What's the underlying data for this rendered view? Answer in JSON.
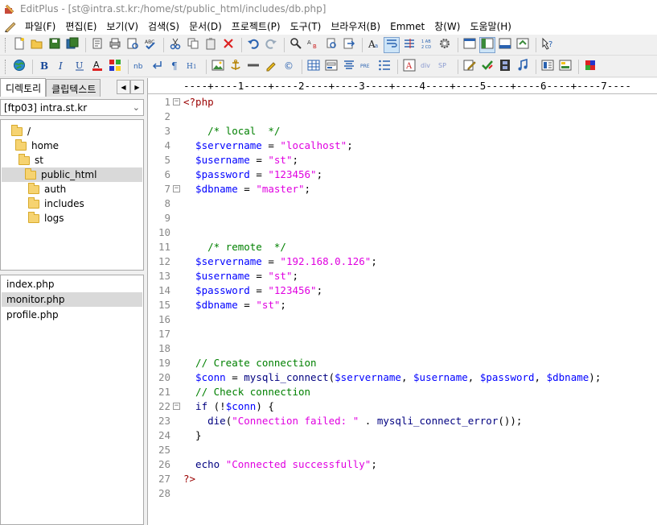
{
  "window": {
    "title": "EditPlus - [st@intra.st.kr:/home/st/public_html/includes/db.php]"
  },
  "menu": [
    {
      "label": "파일(F)"
    },
    {
      "label": "편집(E)"
    },
    {
      "label": "보기(V)"
    },
    {
      "label": "검색(S)"
    },
    {
      "label": "문서(D)"
    },
    {
      "label": "프로젝트(P)"
    },
    {
      "label": "도구(T)"
    },
    {
      "label": "브라우저(B)"
    },
    {
      "label": "Emmet"
    },
    {
      "label": "창(W)"
    },
    {
      "label": "도움말(H)"
    }
  ],
  "toolbar1": [
    "new-file-icon",
    "open-folder-icon",
    "save-icon",
    "save-all-icon",
    "sep",
    "cut-icon",
    "print-icon",
    "preview-icon",
    "spellcheck-icon",
    "sep",
    "scissors-icon",
    "copy-icon",
    "paste-icon",
    "delete-icon",
    "sep",
    "undo-icon",
    "redo-icon",
    "sep",
    "find-icon",
    "replace-icon",
    "find-in-files-icon",
    "goto-line-icon",
    "sep",
    "font-icon",
    "word-wrap-icon",
    "column-icon",
    "ruler-icon",
    "settings-icon",
    "sep",
    "window-icon",
    "sidebar-icon",
    "output-icon",
    "cliptext-icon",
    "sep",
    "help-icon"
  ],
  "toolbar2": [
    "browser-icon",
    "sep",
    "bold-icon",
    "italic-icon",
    "underline-icon",
    "font-color-icon",
    "color-palette-icon",
    "sep",
    "nbsp-icon",
    "break-icon",
    "paragraph-icon",
    "heading-icon",
    "sep",
    "image-icon",
    "anchor-icon",
    "hr-icon",
    "marker-icon",
    "copyright-icon",
    "sep",
    "table-icon",
    "form-icon",
    "center-icon",
    "pre-icon",
    "list-icon",
    "sep",
    "text-icon",
    "div-icon",
    "span-icon",
    "sep",
    "edit-icon",
    "check-icon",
    "film-icon",
    "music-icon",
    "sep",
    "layout-icon",
    "panel-icon",
    "sep",
    "palette-icon"
  ],
  "sidebar": {
    "tabs": [
      {
        "label": "디렉토리"
      },
      {
        "label": "클립텍스트"
      }
    ],
    "ftp_account": "[ftp03] intra.st.kr",
    "tree": [
      {
        "label": "/",
        "depth": 0
      },
      {
        "label": "home",
        "depth": 1
      },
      {
        "label": "st",
        "depth": 2
      },
      {
        "label": "public_html",
        "depth": 3
      },
      {
        "label": "auth",
        "depth": 4
      },
      {
        "label": "includes",
        "depth": 4
      },
      {
        "label": "logs",
        "depth": 4
      }
    ],
    "files": [
      {
        "label": "index.php"
      },
      {
        "label": "monitor.php"
      },
      {
        "label": "profile.php"
      }
    ]
  },
  "editor": {
    "ruler": "----+----1----+----2----+----3----+----4----+----5----+----6----+----7----",
    "lines": [
      {
        "n": "1",
        "fold": true,
        "tokens": [
          {
            "t": "<?php",
            "c": "tag"
          }
        ]
      },
      {
        "n": "2",
        "tokens": []
      },
      {
        "n": "3",
        "tokens": [
          {
            "t": "    /* local  */",
            "c": "com"
          }
        ]
      },
      {
        "n": "4",
        "tokens": [
          {
            "t": "  $servername",
            "c": "var"
          },
          {
            "t": " = ",
            "c": "op"
          },
          {
            "t": "\"localhost\"",
            "c": "str"
          },
          {
            "t": ";",
            "c": "op"
          }
        ]
      },
      {
        "n": "5",
        "tokens": [
          {
            "t": "  $username",
            "c": "var"
          },
          {
            "t": " = ",
            "c": "op"
          },
          {
            "t": "\"st\"",
            "c": "str"
          },
          {
            "t": ";",
            "c": "op"
          }
        ]
      },
      {
        "n": "6",
        "tokens": [
          {
            "t": "  $password",
            "c": "var"
          },
          {
            "t": " = ",
            "c": "op"
          },
          {
            "t": "\"123456\"",
            "c": "str"
          },
          {
            "t": ";",
            "c": "op"
          }
        ]
      },
      {
        "n": "7",
        "fold": true,
        "tokens": [
          {
            "t": "  $dbname",
            "c": "var"
          },
          {
            "t": " = ",
            "c": "op"
          },
          {
            "t": "\"master\"",
            "c": "str"
          },
          {
            "t": ";",
            "c": "op"
          }
        ]
      },
      {
        "n": "8",
        "tokens": []
      },
      {
        "n": "9",
        "tokens": []
      },
      {
        "n": "10",
        "tokens": []
      },
      {
        "n": "11",
        "tokens": [
          {
            "t": "    /* remote  */",
            "c": "com"
          }
        ]
      },
      {
        "n": "12",
        "tokens": [
          {
            "t": "  $servername",
            "c": "var"
          },
          {
            "t": " = ",
            "c": "op"
          },
          {
            "t": "\"192.168.0.126\"",
            "c": "str"
          },
          {
            "t": ";",
            "c": "op"
          }
        ]
      },
      {
        "n": "13",
        "tokens": [
          {
            "t": "  $username",
            "c": "var"
          },
          {
            "t": " = ",
            "c": "op"
          },
          {
            "t": "\"st\"",
            "c": "str"
          },
          {
            "t": ";",
            "c": "op"
          }
        ]
      },
      {
        "n": "14",
        "tokens": [
          {
            "t": "  $password",
            "c": "var"
          },
          {
            "t": " = ",
            "c": "op"
          },
          {
            "t": "\"123456\"",
            "c": "str"
          },
          {
            "t": ";",
            "c": "op"
          }
        ]
      },
      {
        "n": "15",
        "tokens": [
          {
            "t": "  $dbname",
            "c": "var"
          },
          {
            "t": " = ",
            "c": "op"
          },
          {
            "t": "\"st\"",
            "c": "str"
          },
          {
            "t": ";",
            "c": "op"
          }
        ]
      },
      {
        "n": "16",
        "tokens": []
      },
      {
        "n": "17",
        "tokens": []
      },
      {
        "n": "18",
        "tokens": []
      },
      {
        "n": "19",
        "tokens": [
          {
            "t": "  // Create connection",
            "c": "com"
          }
        ]
      },
      {
        "n": "20",
        "tokens": [
          {
            "t": "  $conn",
            "c": "var"
          },
          {
            "t": " = ",
            "c": "op"
          },
          {
            "t": "mysqli_connect",
            "c": "fn"
          },
          {
            "t": "(",
            "c": "op"
          },
          {
            "t": "$servername",
            "c": "var"
          },
          {
            "t": ", ",
            "c": "op"
          },
          {
            "t": "$username",
            "c": "var"
          },
          {
            "t": ", ",
            "c": "op"
          },
          {
            "t": "$password",
            "c": "var"
          },
          {
            "t": ", ",
            "c": "op"
          },
          {
            "t": "$dbname",
            "c": "var"
          },
          {
            "t": ");",
            "c": "op"
          }
        ]
      },
      {
        "n": "21",
        "tokens": [
          {
            "t": "  // Check connection",
            "c": "com"
          }
        ]
      },
      {
        "n": "22",
        "fold": true,
        "tokens": [
          {
            "t": "  if",
            "c": "fn"
          },
          {
            "t": " (!",
            "c": "op"
          },
          {
            "t": "$conn",
            "c": "var"
          },
          {
            "t": ") {",
            "c": "op"
          }
        ]
      },
      {
        "n": "23",
        "tokens": [
          {
            "t": "    die",
            "c": "fn"
          },
          {
            "t": "(",
            "c": "op"
          },
          {
            "t": "\"Connection failed: \"",
            "c": "str"
          },
          {
            "t": " . ",
            "c": "op"
          },
          {
            "t": "mysqli_connect_error",
            "c": "fn"
          },
          {
            "t": "());",
            "c": "op"
          }
        ]
      },
      {
        "n": "24",
        "tokens": [
          {
            "t": "  }",
            "c": "op"
          }
        ]
      },
      {
        "n": "25",
        "tokens": []
      },
      {
        "n": "26",
        "tokens": [
          {
            "t": "  echo",
            "c": "fn"
          },
          {
            "t": " ",
            "c": "op"
          },
          {
            "t": "\"Connected successfully\"",
            "c": "str"
          },
          {
            "t": ";",
            "c": "op"
          }
        ]
      },
      {
        "n": "27",
        "tokens": [
          {
            "t": "?>",
            "c": "tag"
          }
        ]
      },
      {
        "n": "28",
        "tokens": []
      }
    ]
  },
  "colors": {
    "tag": "#9a0000",
    "comment": "#008000",
    "variable": "#0000ff",
    "string": "#e000e0",
    "function": "#000080",
    "selection": "#d9d9d9"
  }
}
